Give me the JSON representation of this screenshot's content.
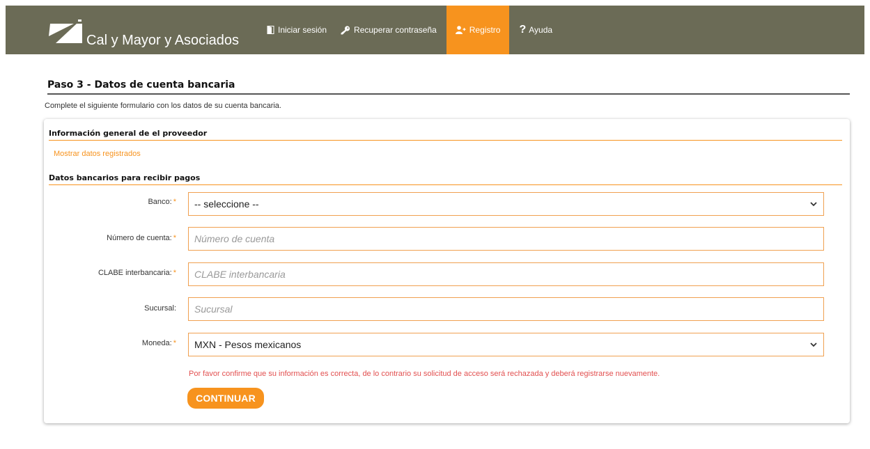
{
  "brand": {
    "name": "Cal y Mayor y Asociados",
    "logo_icon": "cal-y-mayor-logo"
  },
  "colors": {
    "header_bg": "#6b6b56",
    "accent": "#f7931e",
    "warning": "#e25050"
  },
  "nav": {
    "login": {
      "icon": "door-icon",
      "label": "Iniciar sesión"
    },
    "recover": {
      "icon": "key-icon",
      "label": "Recuperar contraseña"
    },
    "register": {
      "icon": "user-plus-icon",
      "label": "Registro"
    },
    "help": {
      "icon": "question-icon",
      "label": "Ayuda",
      "glyph": "?"
    }
  },
  "page": {
    "title": "Paso 3 - Datos de cuenta bancaria",
    "intro": "Complete el siguiente formulario con los datos de su cuenta bancaria."
  },
  "card": {
    "section1_title": "Información general de el proveedor",
    "show_link": "Mostrar datos registrados",
    "section2_title": "Datos bancarios para recibir pagos"
  },
  "form": {
    "required_mark": "*",
    "banco": {
      "label": "Banco:",
      "value": "-- seleccione --"
    },
    "numero": {
      "label": "Número de cuenta:",
      "placeholder": "Número de cuenta"
    },
    "clabe": {
      "label": "CLABE interbancaria:",
      "placeholder": "CLABE interbancaria"
    },
    "sucursal": {
      "label": "Sucursal:",
      "placeholder": "Sucursal"
    },
    "moneda": {
      "label": "Moneda:",
      "value": "MXN - Pesos mexicanos"
    }
  },
  "notice": "Por favor confirme que su información es correcta, de lo contrario su solicitud de acceso será rechazada y deberá registrarse nuevamente.",
  "submit_label": "CONTINUAR"
}
